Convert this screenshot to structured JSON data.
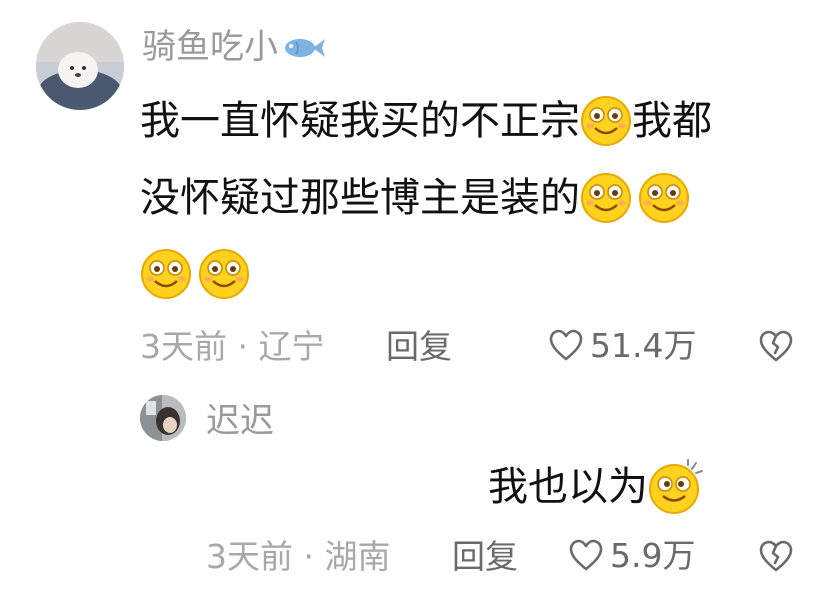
{
  "comment": {
    "username": "骑鱼吃小",
    "username_icon": "fish-icon",
    "lines": [
      {
        "text": "我一直怀疑我买的不正宗",
        "emoji_after": 1,
        "tail": "我都"
      },
      {
        "text": "没怀疑过那些博主是装的",
        "emoji_after": 2,
        "tail": ""
      },
      {
        "text": "",
        "emoji_after": 2,
        "tail": ""
      }
    ],
    "emoji_name": "smile-emoji-icon",
    "time_location": "3天前 · 辽宁",
    "reply_label": "回复",
    "like_count": "51.4万",
    "like_icon": "heart-outline-icon",
    "dislike_icon": "broken-heart-icon"
  },
  "reply": {
    "username": "迟迟",
    "text": "我也以为",
    "emoji_name": "dizzy-smile-emoji-icon",
    "time_location": "3天前 · 湖南",
    "reply_label": "回复",
    "like_count": "5.9万",
    "like_icon": "heart-outline-icon",
    "dislike_icon": "broken-heart-icon"
  }
}
